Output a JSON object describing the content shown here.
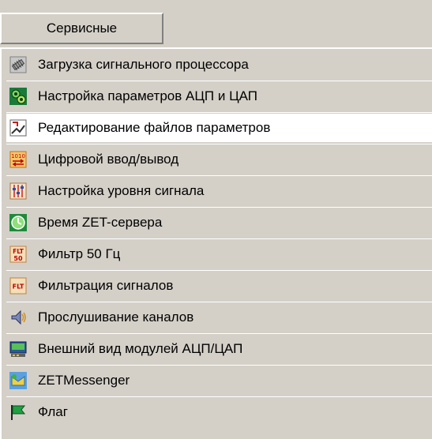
{
  "menu": {
    "title": "Сервисные"
  },
  "items": [
    {
      "label": "Загрузка сигнального процессора",
      "icon": "chip-icon"
    },
    {
      "label": "Настройка параметров АЦП и ЦАП",
      "icon": "gears-icon"
    },
    {
      "label": "Редактирование файлов параметров",
      "icon": "edit-files-icon"
    },
    {
      "label": "Цифровой ввод/вывод",
      "icon": "digital-io-icon"
    },
    {
      "label": "Настройка уровня сигнала",
      "icon": "sliders-icon"
    },
    {
      "label": "Время ZET-сервера",
      "icon": "clock-icon"
    },
    {
      "label": "Фильтр 50 Гц",
      "icon": "flt-50-icon"
    },
    {
      "label": "Фильтрация сигналов",
      "icon": "flt-icon"
    },
    {
      "label": "Прослушивание каналов",
      "icon": "speaker-icon"
    },
    {
      "label": "Внешний вид модулей АЦП/ЦАП",
      "icon": "module-icon"
    },
    {
      "label": "ZETMessenger",
      "icon": "messenger-icon"
    },
    {
      "label": "Флаг",
      "icon": "flag-icon"
    }
  ],
  "highlighted_index": 2,
  "colors": {
    "face": "#d4d0c8",
    "highlight": "#ffffff"
  }
}
